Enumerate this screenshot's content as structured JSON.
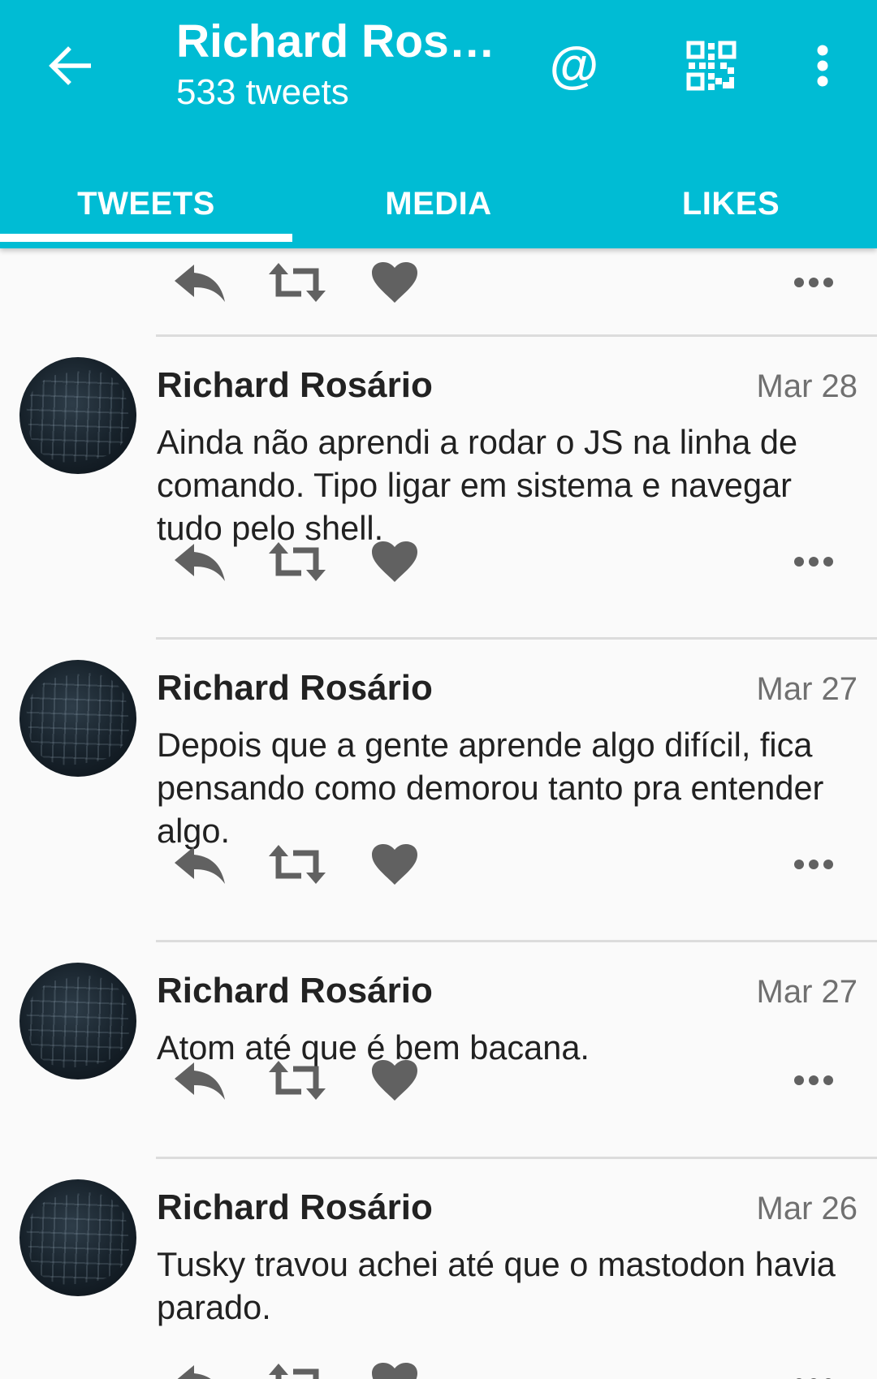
{
  "header": {
    "title": "Richard Ros…",
    "subtitle": "533 tweets",
    "mention_glyph": "@",
    "icons": [
      "back-arrow-icon",
      "mention-icon",
      "qr-code-icon",
      "overflow-menu-icon"
    ],
    "accent_color": "#00bcd4"
  },
  "tabs": [
    {
      "label": "TWEETS",
      "active": true
    },
    {
      "label": "MEDIA",
      "active": false
    },
    {
      "label": "LIKES",
      "active": false
    }
  ],
  "tweets": [
    {
      "author": "Richard Rosário",
      "date": "Mar 28",
      "text": "Ainda não aprendi a rodar o JS na linha de comando. Tipo ligar em sistema e navegar tudo pelo shell."
    },
    {
      "author": "Richard Rosário",
      "date": "Mar 27",
      "text": "Depois que a gente aprende algo difícil, fica pensando como demorou tanto pra entender algo."
    },
    {
      "author": "Richard Rosário",
      "date": "Mar 27",
      "text": "Atom até que é bem bacana."
    },
    {
      "author": "Richard Rosário",
      "date": "Mar 26",
      "text": "Tusky travou achei até que o mastodon havia parado."
    }
  ],
  "action_icons": [
    "reply-icon",
    "boost-icon",
    "favourite-icon",
    "more-icon"
  ],
  "icon_color": "#616161"
}
